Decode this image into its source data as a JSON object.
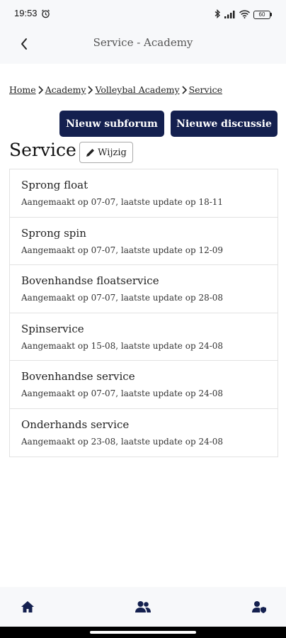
{
  "status_bar": {
    "time": "19:53",
    "battery": "60",
    "icons": [
      "alarm-icon",
      "bluetooth-icon",
      "signal-icon",
      "wifi-icon",
      "battery-icon"
    ]
  },
  "header": {
    "title": "Service - Academy",
    "back_icon": "chevron-left-icon"
  },
  "breadcrumb": [
    "Home",
    "Academy",
    "Volleybal Academy",
    "Service"
  ],
  "actions": {
    "new_subforum": "Nieuw subforum",
    "new_discussion": "Nieuwe discussie"
  },
  "page": {
    "title": "Service",
    "edit_label": "Wijzig"
  },
  "forums": [
    {
      "title": "Sprong float",
      "meta": "Aangemaakt op 07-07, laatste update op 18-11"
    },
    {
      "title": "Sprong spin",
      "meta": "Aangemaakt op 07-07, laatste update op 12-09"
    },
    {
      "title": "Bovenhandse floatservice",
      "meta": "Aangemaakt op 07-07, laatste update op 28-08"
    },
    {
      "title": "Spinservice",
      "meta": "Aangemaakt op 15-08, laatste update op 24-08"
    },
    {
      "title": "Bovenhandse service",
      "meta": "Aangemaakt op 07-07, laatste update op 24-08"
    },
    {
      "title": "Onderhands service",
      "meta": "Aangemaakt op 23-08, laatste update op 24-08"
    }
  ],
  "bottom_nav": {
    "items": [
      "home-icon",
      "group-icon",
      "user-shield-icon"
    ]
  },
  "colors": {
    "primary": "#14204f",
    "bar_background": "#f7f8fa",
    "border": "#e2e2e2"
  }
}
